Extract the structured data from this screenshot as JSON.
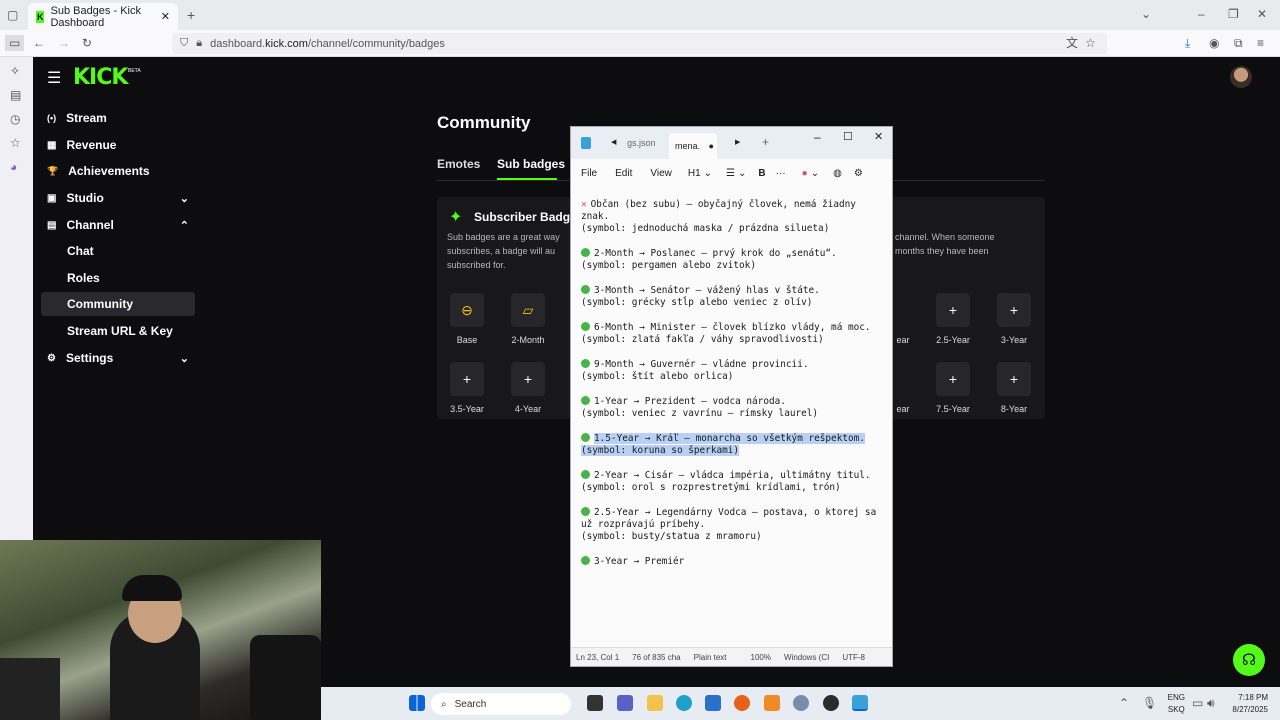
{
  "browser": {
    "tab_title": "Sub Badges - Kick Dashboard",
    "new_tab": "+",
    "url_prefix": "dashboard.",
    "url_domain": "kick.com",
    "url_path": "/channel/community/badges"
  },
  "kick": {
    "logo": "KICK",
    "logo_tag": "BETA",
    "nav": [
      {
        "label": "Stream",
        "icon": "(•)"
      },
      {
        "label": "Revenue",
        "icon": "▦"
      },
      {
        "label": "Achievements",
        "icon": "🏆"
      },
      {
        "label": "Studio",
        "icon": "▣"
      },
      {
        "label": "Channel",
        "icon": "▤"
      },
      {
        "label": "Chat"
      },
      {
        "label": "Roles"
      },
      {
        "label": "Community"
      },
      {
        "label": "Stream URL & Key"
      },
      {
        "label": "Settings",
        "icon": "⚙"
      }
    ],
    "page_title": "Community",
    "tabs": [
      "Emotes",
      "Sub badges"
    ],
    "card_title": "Subscriber Badg",
    "card_desc_left": "Sub badges are a great way\nsubscribes, a badge will au\nsubscribed for.",
    "card_desc_right": "channel. When someone\nmonths they have been",
    "badges_row1": [
      "Base",
      "2-Month",
      "ear",
      "2.5-Year",
      "3-Year"
    ],
    "badges_row2": [
      "3.5-Year",
      "4-Year",
      "ear",
      "7.5-Year",
      "8-Year"
    ]
  },
  "notepad": {
    "tab_inactive": "gs.json",
    "tab_active": "mena.",
    "menu": [
      "File",
      "Edit",
      "View",
      "H1"
    ],
    "bold": "B",
    "more": "···",
    "entries": [
      {
        "marker": "x",
        "line1": "Občan (bez subu) – obyčajný človek, nemá žiadny znak.",
        "line2": "(symbol: jednoduchá maska / prázdna silueta)",
        "selected": false
      },
      {
        "marker": "dot",
        "line1": "2-Month → Poslanec – prvý krok do „senátu“.",
        "line2": "(symbol: pergamen alebo zvitok)",
        "selected": false
      },
      {
        "marker": "dot",
        "line1": "3-Month → Senátor – vážený hlas v štáte.",
        "line2": "(symbol: grécky stĺp alebo veniec z olív)",
        "selected": false
      },
      {
        "marker": "dot",
        "line1": "6-Month → Minister – človek blízko vlády, má moc.",
        "line2": "(symbol: zlatá fakľa / váhy spravodlivosti)",
        "selected": false
      },
      {
        "marker": "dot",
        "line1": "9-Month → Guvernér – vládne provincii.",
        "line2": "(symbol: štít alebo orlica)",
        "selected": false
      },
      {
        "marker": "dot",
        "line1": "1-Year → Prezident – vodca národa.",
        "line2": "(symbol: veniec z vavrínu – rímsky laurel)",
        "selected": false
      },
      {
        "marker": "dot",
        "line1": "1.5-Year → Kráľ – monarcha so všetkým rešpektom.",
        "line2": "(symbol: koruna so šperkami)",
        "selected": true
      },
      {
        "marker": "dot",
        "line1": "2-Year → Cisár – vládca impéria, ultimátny titul.",
        "line2": "(symbol: orol s rozprestretými krídlami, trón)",
        "selected": false
      },
      {
        "marker": "dot",
        "line1": "2.5-Year → Legendárny Vodca – postava, o ktorej sa už rozprávajú príbehy.",
        "line2": "(symbol: busty/statua z mramoru)",
        "selected": false
      },
      {
        "marker": "dot",
        "line1": "3-Year → Premiér",
        "line2": "",
        "selected": false
      }
    ],
    "status": [
      "Ln 23, Col 1",
      "76 of 835 cha",
      "Plain text",
      "100%",
      "Windows (CI",
      "UTF-8"
    ]
  },
  "taskbar": {
    "search": "Search",
    "lang1": "ENG",
    "lang2": "SKQ",
    "time": "7:18 PM",
    "date": "8/27/2025"
  }
}
